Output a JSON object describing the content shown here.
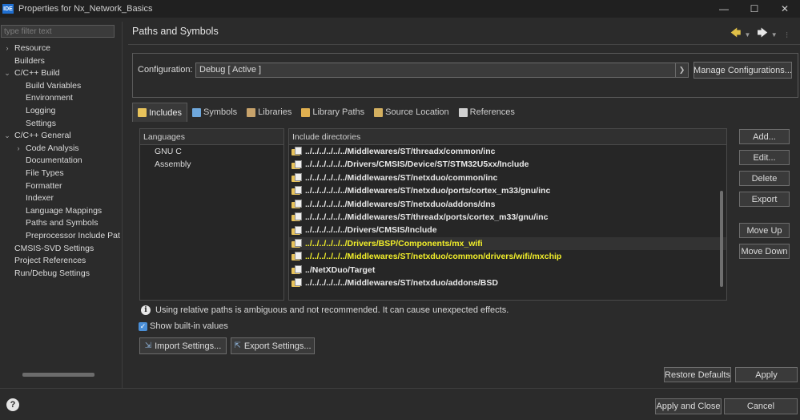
{
  "window": {
    "app_icon": "IDE",
    "title": "Properties for Nx_Network_Basics",
    "minimize": "—",
    "maximize": "☐",
    "close": "✕"
  },
  "filter": {
    "placeholder": "type filter text"
  },
  "nav": [
    {
      "label": "Resource",
      "level": 0,
      "expandable": true
    },
    {
      "label": "Builders",
      "level": 0,
      "expandable": false
    },
    {
      "label": "C/C++ Build",
      "level": 0,
      "expandable": true,
      "expanded": true
    },
    {
      "label": "Build Variables",
      "level": 1
    },
    {
      "label": "Environment",
      "level": 1
    },
    {
      "label": "Logging",
      "level": 1
    },
    {
      "label": "Settings",
      "level": 1
    },
    {
      "label": "C/C++ General",
      "level": 0,
      "expandable": true,
      "expanded": true
    },
    {
      "label": "Code Analysis",
      "level": 1,
      "expandable": true
    },
    {
      "label": "Documentation",
      "level": 1
    },
    {
      "label": "File Types",
      "level": 1
    },
    {
      "label": "Formatter",
      "level": 1
    },
    {
      "label": "Indexer",
      "level": 1
    },
    {
      "label": "Language Mappings",
      "level": 1
    },
    {
      "label": "Paths and Symbols",
      "level": 1,
      "selected": true
    },
    {
      "label": "Preprocessor Include Pat",
      "level": 1
    },
    {
      "label": "CMSIS-SVD Settings",
      "level": 0
    },
    {
      "label": "Project References",
      "level": 0
    },
    {
      "label": "Run/Debug Settings",
      "level": 0
    }
  ],
  "page": {
    "title": "Paths and Symbols"
  },
  "configuration": {
    "label": "Configuration:",
    "value": "Debug  [ Active ]",
    "manage_button": "Manage Configurations..."
  },
  "tabs": [
    {
      "label": "Includes",
      "icon": "includes-icon",
      "color": "#e8c35b",
      "active": true
    },
    {
      "label": "Symbols",
      "icon": "symbols-icon",
      "color": "#6fa8dc"
    },
    {
      "label": "Libraries",
      "icon": "libraries-icon",
      "color": "#c8a36b"
    },
    {
      "label": "Library Paths",
      "icon": "library-paths-icon",
      "color": "#e0b050"
    },
    {
      "label": "Source Location",
      "icon": "source-location-icon",
      "color": "#d4b060"
    },
    {
      "label": "References",
      "icon": "references-icon",
      "color": "#d0d0d0"
    }
  ],
  "languages": {
    "header": "Languages",
    "items": [
      "GNU C",
      "Assembly"
    ]
  },
  "includes": {
    "header": "Include directories",
    "rows": [
      {
        "path": "../../../../../../Middlewares/ST/threadx/common/inc"
      },
      {
        "path": "../../../../../../Drivers/CMSIS/Device/ST/STM32U5xx/Include"
      },
      {
        "path": "../../../../../../Middlewares/ST/netxduo/common/inc"
      },
      {
        "path": "../../../../../../Middlewares/ST/netxduo/ports/cortex_m33/gnu/inc"
      },
      {
        "path": "../../../../../../Middlewares/ST/netxduo/addons/dns"
      },
      {
        "path": "../../../../../../Middlewares/ST/threadx/ports/cortex_m33/gnu/inc"
      },
      {
        "path": "../../../../../../Drivers/CMSIS/Include"
      },
      {
        "path": "../../../../../../Drivers/BSP/Components/mx_wifi",
        "highlight": true
      },
      {
        "path": "../../../../../../Middlewares/ST/netxduo/common/drivers/wifi/mxchip",
        "highlight": true
      },
      {
        "path": "../NetXDuo/Target"
      },
      {
        "path": "../../../../../../Middlewares/ST/netxduo/addons/BSD"
      }
    ]
  },
  "side_buttons": {
    "add": "Add...",
    "edit": "Edit...",
    "delete": "Delete",
    "export": "Export",
    "move_up": "Move Up",
    "move_down": "Move Down"
  },
  "info": {
    "text": "Using relative paths is ambiguous and not recommended. It can cause unexpected effects."
  },
  "show_builtin": {
    "label": "Show built-in values",
    "checked": true
  },
  "import_settings": "Import Settings...",
  "export_settings": "Export Settings...",
  "restore_defaults": "Restore Defaults",
  "apply": "Apply",
  "apply_and_close": "Apply and Close",
  "cancel": "Cancel",
  "colors": {
    "background": "#2b2b2b",
    "highlight_text": "#f2ef2a",
    "accent": "#4a8fd8"
  }
}
